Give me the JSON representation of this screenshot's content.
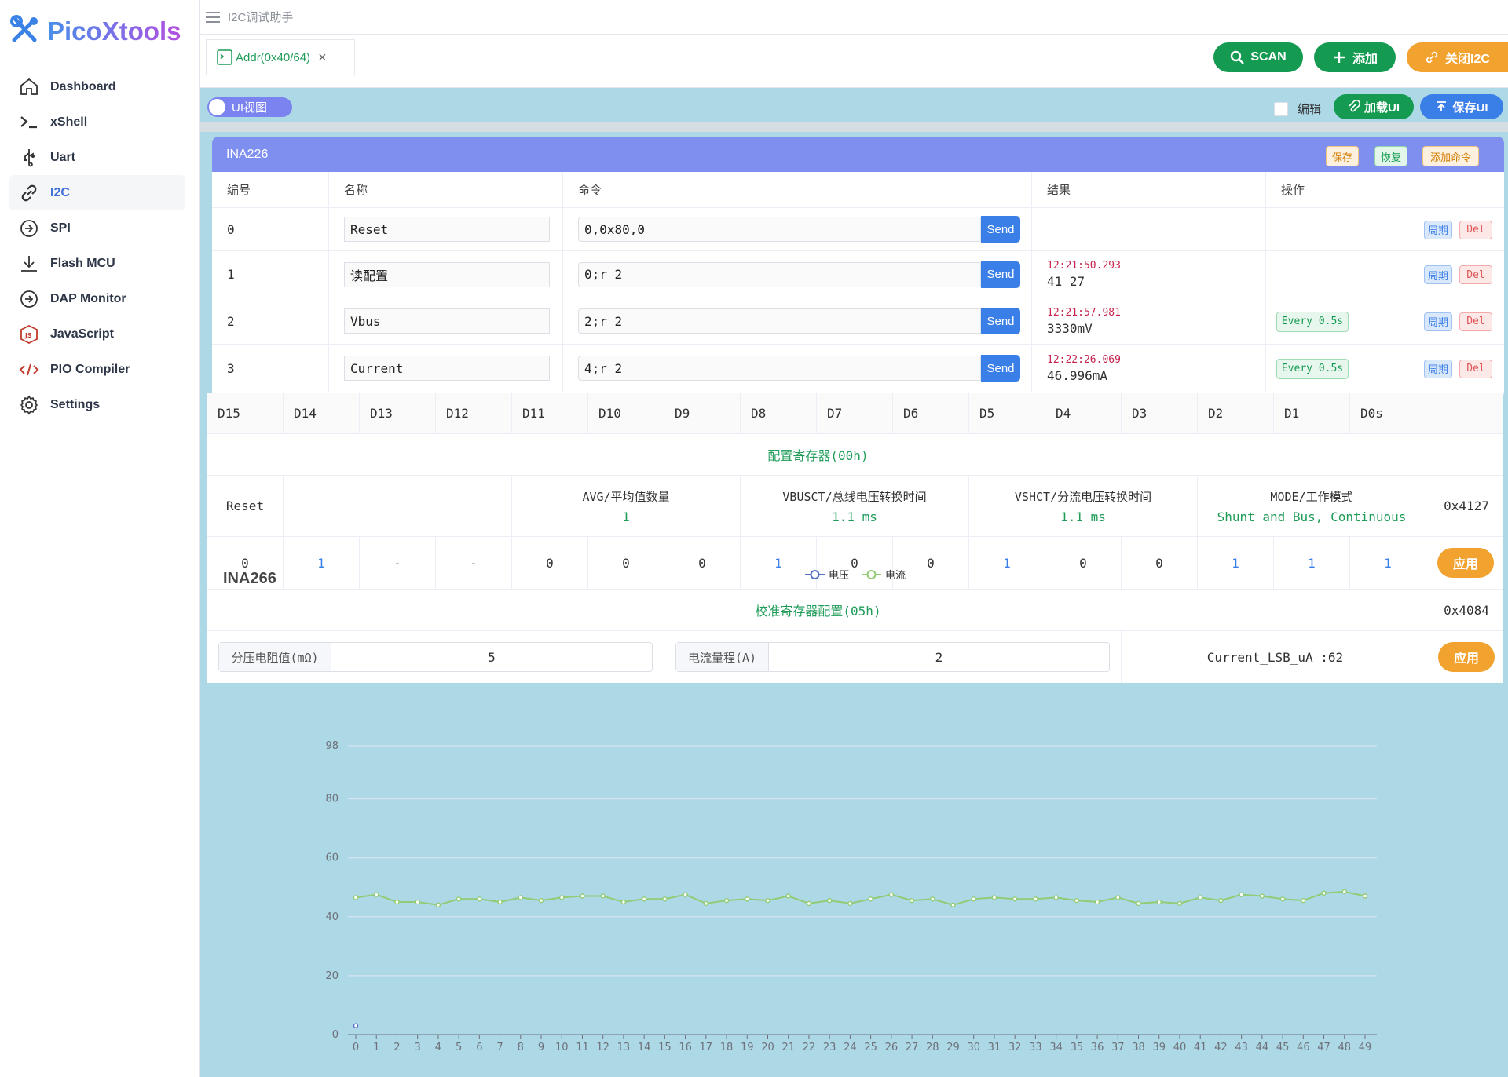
{
  "app": {
    "logo_text": "PicoXtools",
    "page_title": "I2C调试助手"
  },
  "sidebar": {
    "items": [
      {
        "label": "Dashboard",
        "icon": "home-icon"
      },
      {
        "label": "xShell",
        "icon": "terminal-icon"
      },
      {
        "label": "Uart",
        "icon": "usb-icon"
      },
      {
        "label": "I2C",
        "icon": "link-icon",
        "active": true
      },
      {
        "label": "SPI",
        "icon": "arrow-circle-icon"
      },
      {
        "label": "Flash MCU",
        "icon": "download-icon"
      },
      {
        "label": "DAP Monitor",
        "icon": "arrow-circle-icon"
      },
      {
        "label": "JavaScript",
        "icon": "js-icon"
      },
      {
        "label": "PIO Compiler",
        "icon": "code-icon"
      },
      {
        "label": "Settings",
        "icon": "gear-icon"
      }
    ]
  },
  "tab": {
    "label": "Addr(0x40/64)"
  },
  "actions": {
    "scan": "SCAN",
    "add": "添加",
    "close": "关闭I2C"
  },
  "toolbar": {
    "ui_view": "UI视图",
    "edit": "编辑",
    "load_ui": "加载UI",
    "save_ui": "保存UI"
  },
  "panel": {
    "title": "INA226",
    "save": "保存",
    "restore": "恢复",
    "add_cmd": "添加命令",
    "columns": [
      "编号",
      "名称",
      "命令",
      "结果",
      "操作"
    ],
    "send_label": "Send",
    "period_label": "周期",
    "del_label": "Del",
    "rows": [
      {
        "id": "0",
        "name": "Reset",
        "cmd": "0,0x80,0",
        "time": "",
        "result": "",
        "period": ""
      },
      {
        "id": "1",
        "name": "读配置",
        "cmd": "0;r 2",
        "time": "12:21:50.293",
        "result": "41 27",
        "period": ""
      },
      {
        "id": "2",
        "name": "Vbus",
        "cmd": "2;r 2",
        "time": "12:21:57.981",
        "result": "3330mV",
        "period": "Every 0.5s"
      },
      {
        "id": "3",
        "name": "Current",
        "cmd": "4;r 2",
        "time": "12:22:26.069",
        "result": "46.996mA",
        "period": "Every 0.5s"
      }
    ]
  },
  "register": {
    "bits": [
      "D15",
      "D14",
      "D13",
      "D12",
      "D11",
      "D10",
      "D9",
      "D8",
      "D7",
      "D6",
      "D5",
      "D4",
      "D3",
      "D2",
      "D1",
      "D0s"
    ],
    "config_title": "配置寄存器(00h)",
    "reset_label": "Reset",
    "fields": [
      {
        "name": "AVG/平均值数量",
        "value": "1"
      },
      {
        "name": "VBUSCT/总线电压转换时间",
        "value": "1.1 ms"
      },
      {
        "name": "VSHCT/分流电压转换时间",
        "value": "1.1 ms"
      },
      {
        "name": "MODE/工作模式",
        "value": "Shunt and Bus, Continuous"
      }
    ],
    "config_hex": "0x4127",
    "bit_values": [
      "0",
      "1",
      "-",
      "-",
      "0",
      "0",
      "0",
      "1",
      "0",
      "0",
      "1",
      "0",
      "0",
      "1",
      "1",
      "1"
    ],
    "apply": "应用",
    "calib_title": "校准寄存器配置(05h)",
    "calib_hex": "0x4084",
    "shunt_label": "分压电阻值(mΩ)",
    "shunt_value": "5",
    "range_label": "电流量程(A)",
    "range_value": "2",
    "lsb_text": "Current_LSB_uA :62"
  },
  "chart_data": {
    "type": "line",
    "title": "INA266",
    "x": [
      0,
      1,
      2,
      3,
      4,
      5,
      6,
      7,
      8,
      9,
      10,
      11,
      12,
      13,
      14,
      15,
      16,
      17,
      18,
      19,
      20,
      21,
      22,
      23,
      24,
      25,
      26,
      27,
      28,
      29,
      30,
      31,
      32,
      33,
      34,
      35,
      36,
      37,
      38,
      39,
      40,
      41,
      42,
      43,
      44,
      45,
      46,
      47,
      48,
      49
    ],
    "y_ticks": [
      0,
      20,
      40,
      60,
      80,
      98
    ],
    "ylim": [
      0,
      98
    ],
    "series": [
      {
        "name": "电压",
        "color": "#5470c6",
        "values": [
          3
        ]
      },
      {
        "name": "电流",
        "color": "#91cc75",
        "values": [
          46.5,
          47.5,
          45,
          45,
          44,
          46,
          46,
          45,
          46.5,
          45.5,
          46.5,
          47,
          47,
          45,
          46,
          46,
          47.5,
          44.5,
          45.5,
          46,
          45.5,
          47,
          44.5,
          45.5,
          44.5,
          46,
          47.5,
          45.5,
          46,
          44,
          46,
          46.5,
          46,
          46,
          46.5,
          45.5,
          45,
          46.5,
          44.5,
          45,
          44.5,
          46.5,
          45.5,
          47.5,
          47,
          46,
          45.5,
          48,
          48.5,
          47
        ]
      }
    ],
    "grid": true,
    "legend_position": "top-center"
  }
}
